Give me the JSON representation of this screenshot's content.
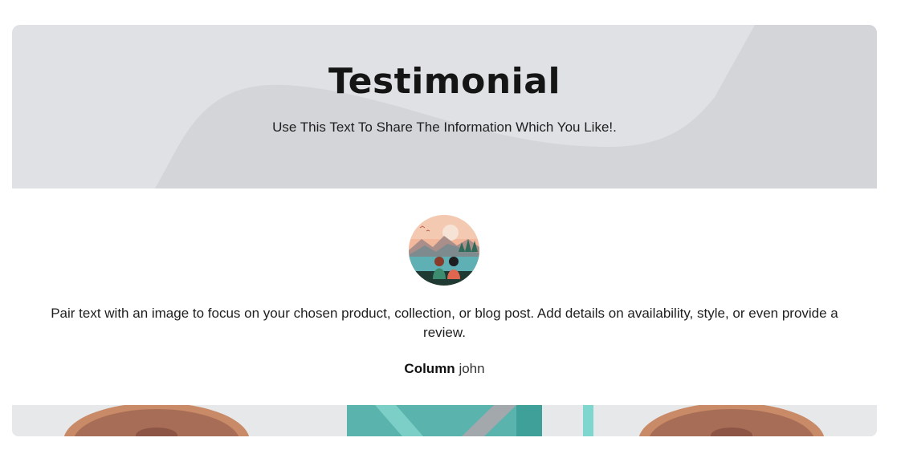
{
  "hero": {
    "title": "Testimonial",
    "subtitle": "Use This Text To Share The Information Which You Like!."
  },
  "testimonial": {
    "avatar_icon": "landscape-couple-illustration",
    "quote": "Pair text with an image to focus on your chosen product, collection, or blog post. Add details on availability, style, or even provide a review.",
    "author_label": "Column",
    "author_name": "john"
  },
  "colors": {
    "hero_bg": "#dfe1e4",
    "hero_shape": "#d3d5d9",
    "text": "#1a1a1a"
  }
}
